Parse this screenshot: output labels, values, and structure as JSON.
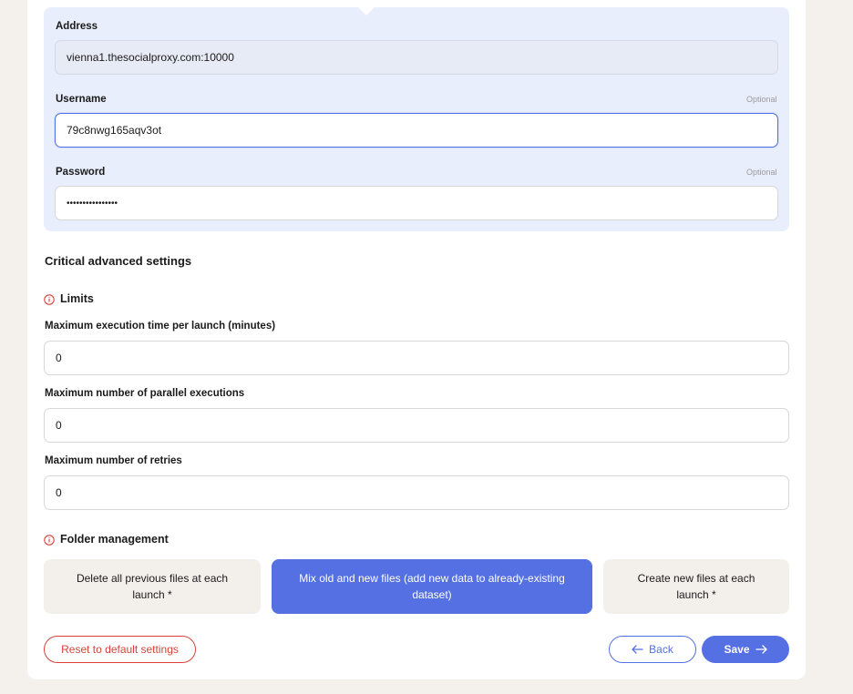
{
  "proxy": {
    "address_label": "Address",
    "address_value": "vienna1.thesocialproxy.com:10000",
    "username_label": "Username",
    "username_optional": "Optional",
    "username_value": "79c8nwg165aqv3ot",
    "password_label": "Password",
    "password_optional": "Optional",
    "password_value": "••••••••••••••••"
  },
  "advanced": {
    "title": "Critical advanced settings",
    "limits_title": "Limits",
    "max_exec_label": "Maximum execution time per launch (minutes)",
    "max_exec_value": "0",
    "max_parallel_label": "Maximum number of parallel executions",
    "max_parallel_value": "0",
    "max_retries_label": "Maximum number of retries",
    "max_retries_value": "0"
  },
  "folder": {
    "title": "Folder management",
    "options": [
      "Delete all previous files at each launch *",
      "Mix old and new files (add new data to already-existing dataset)",
      "Create new files at each launch *"
    ],
    "selected_index": 1
  },
  "buttons": {
    "reset": "Reset to default settings",
    "back": "Back",
    "save": "Save"
  },
  "colors": {
    "accent": "#5470e2",
    "danger": "#d9413a",
    "panel": "#e9eefc"
  }
}
